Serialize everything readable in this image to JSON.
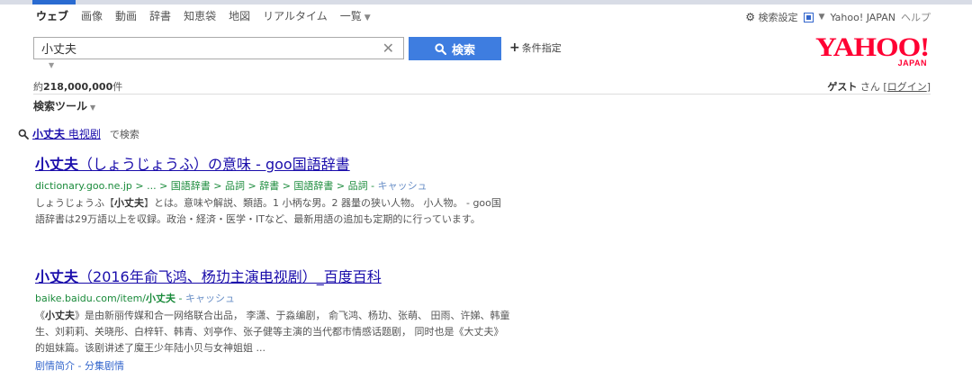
{
  "tabs": [
    {
      "label": "ウェブ",
      "active": true
    },
    {
      "label": "画像"
    },
    {
      "label": "動画"
    },
    {
      "label": "辞書"
    },
    {
      "label": "知恵袋"
    },
    {
      "label": "地図"
    },
    {
      "label": "リアルタイム"
    },
    {
      "label": "一覧"
    }
  ],
  "header": {
    "settings_label": "検索設定",
    "yahoo_japan": "Yahoo! JAPAN",
    "help": "ヘルプ"
  },
  "search": {
    "value": "小丈夫",
    "clear_glyph": "✕",
    "button_label": "検索",
    "conditions_label": "条件指定"
  },
  "logo": {
    "main": "YAHOO!",
    "sub": "JAPAN"
  },
  "stats": {
    "prefix": "約",
    "count": "218,000,000",
    "suffix": "件"
  },
  "guest": {
    "name": "ゲスト",
    "san": "さん",
    "login": "ログイン"
  },
  "tools": {
    "label": "検索ツール"
  },
  "suggestion": {
    "bold": "小丈夫",
    "rest": " 电视剧",
    "tail": "で検索"
  },
  "results": [
    {
      "title_bold": "小丈夫",
      "title_rest": "（しょうじょうふ）の意味 - goo国語辞書",
      "url": "dictionary.goo.ne.jp > ... > 国語辞書 > 品詞 > 辞書 > 国語辞書 > 品詞",
      "cache": "キャッシュ",
      "snippet_pre": "しょうじょうふ【",
      "snippet_bold": "小丈夫",
      "snippet_post": "】とは。意味や解説、類語。1 小柄な男。2 器量の狭い人物。 小人物。 - goo国語辞書は29万語以上を収録。政治・経済・医学・ITなど、最新用語の追加も定期的に行っています。"
    },
    {
      "title_bold": "小丈夫",
      "title_rest": "（2016年俞飞鸿、杨玏主演电视剧）_百度百科",
      "url_pre": "baike.baidu.com/item/",
      "url_bold": "小丈夫",
      "cache": "キャッシュ",
      "snippet_pre": "《",
      "snippet_bold": "小丈夫",
      "snippet_post": "》是由新丽传媒和合一网络联合出品， 李潇、于淼编剧， 俞飞鸿、杨玏、张萌、 田雨、许娣、韩童生、刘莉莉、关晓彤、白梓轩、韩青、刘亭作、张子健等主演的当代都市情感话题剧， 同时也是《大丈夫》的姐妹篇。该剧讲述了魔王少年陆小贝与女神姐姐 ...",
      "sublinks": "剧情简介 - 分集剧情"
    }
  ]
}
